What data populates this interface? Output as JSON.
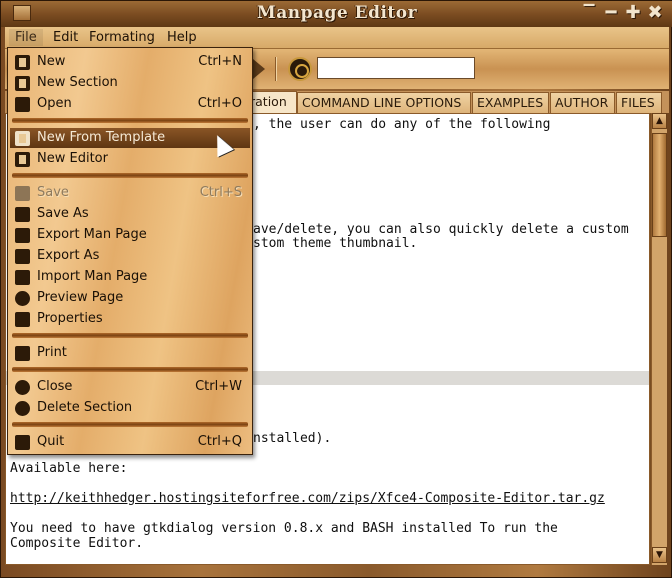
{
  "window": {
    "title": "Manpage Editor",
    "controls": [
      "minimize",
      "restore",
      "maximize",
      "close"
    ]
  },
  "menubar": {
    "items": [
      "File",
      "Edit",
      "Formating",
      "Help"
    ]
  },
  "toolbar": {
    "search_value": ""
  },
  "tabs": [
    {
      "label": "ration",
      "active": true
    },
    {
      "label": "COMMAND LINE OPTIONS",
      "active": false
    },
    {
      "label": "EXAMPLES",
      "active": false
    },
    {
      "label": "AUTHOR",
      "active": false
    },
    {
      "label": "FILES",
      "active": false
    }
  ],
  "file_menu": {
    "items": [
      {
        "label": "New",
        "accel": "Ctrl+N",
        "icon": "new-document-icon"
      },
      {
        "label": "New Section",
        "accel": "",
        "icon": "new-section-icon"
      },
      {
        "label": "Open",
        "accel": "Ctrl+O",
        "icon": "folder-open-icon"
      },
      {
        "label": "New From Template",
        "accel": "",
        "icon": "template-icon",
        "highlighted": true
      },
      {
        "label": "New Editor",
        "accel": "",
        "icon": "new-editor-icon"
      },
      {
        "label": "Save",
        "accel": "Ctrl+S",
        "icon": "save-icon",
        "disabled": true
      },
      {
        "label": "Save As",
        "accel": "",
        "icon": "save-as-icon"
      },
      {
        "label": "Export Man Page",
        "accel": "",
        "icon": "export-icon"
      },
      {
        "label": "Export As",
        "accel": "",
        "icon": "export-as-icon"
      },
      {
        "label": "Import Man Page",
        "accel": "",
        "icon": "import-icon"
      },
      {
        "label": "Preview Page",
        "accel": "",
        "icon": "preview-icon"
      },
      {
        "label": "Properties",
        "accel": "",
        "icon": "properties-icon"
      },
      {
        "label": "Print",
        "accel": "",
        "icon": "print-icon"
      },
      {
        "label": "Close",
        "accel": "Ctrl+W",
        "icon": "close-icon"
      },
      {
        "label": "Delete Section",
        "accel": "",
        "icon": "delete-icon"
      },
      {
        "label": "Quit",
        "accel": "Ctrl+Q",
        "icon": "quit-icon"
      }
    ]
  },
  "editor": {
    "lines": [
      ", the user can do any of the following",
      "ave/delete, you can also quickly delete a custom",
      "stom theme thumbnail.",
      "nstalled).",
      "Available here:",
      "http://keithhedger.hostingsiteforfree.com/zips/Xfce4-Composite-Editor.tar.gz",
      "You need to have gtkdialog version 0.8.x and BASH installed To run the",
      "Composite Editor."
    ]
  }
}
